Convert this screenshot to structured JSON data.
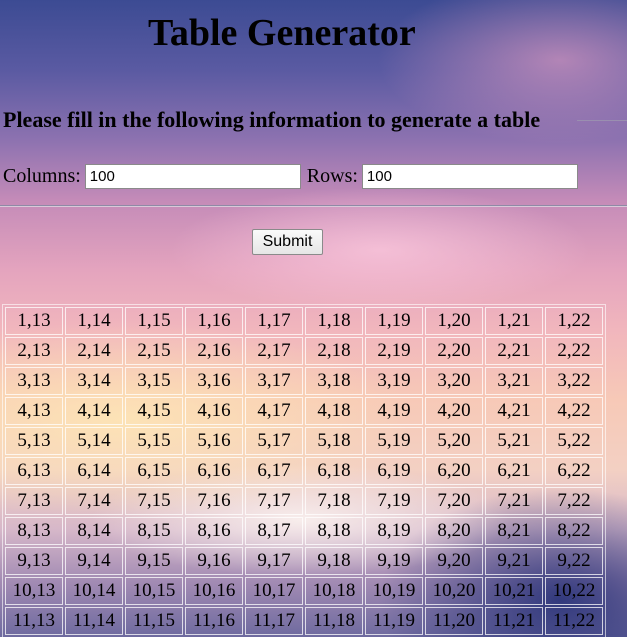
{
  "page": {
    "title": "Table Generator",
    "subtitle": "Please fill in the following information to generate a table"
  },
  "form": {
    "columns_label": "Columns:",
    "columns_value": "100",
    "rows_label": "Rows:",
    "rows_value": "100",
    "submit_label": "Submit"
  },
  "table": {
    "rows": [
      [
        "1,13",
        "1,14",
        "1,15",
        "1,16",
        "1,17",
        "1,18",
        "1,19",
        "1,20",
        "1,21",
        "1,22"
      ],
      [
        "2,13",
        "2,14",
        "2,15",
        "2,16",
        "2,17",
        "2,18",
        "2,19",
        "2,20",
        "2,21",
        "2,22"
      ],
      [
        "3,13",
        "3,14",
        "3,15",
        "3,16",
        "3,17",
        "3,18",
        "3,19",
        "3,20",
        "3,21",
        "3,22"
      ],
      [
        "4,13",
        "4,14",
        "4,15",
        "4,16",
        "4,17",
        "4,18",
        "4,19",
        "4,20",
        "4,21",
        "4,22"
      ],
      [
        "5,13",
        "5,14",
        "5,15",
        "5,16",
        "5,17",
        "5,18",
        "5,19",
        "5,20",
        "5,21",
        "5,22"
      ],
      [
        "6,13",
        "6,14",
        "6,15",
        "6,16",
        "6,17",
        "6,18",
        "6,19",
        "6,20",
        "6,21",
        "6,22"
      ],
      [
        "7,13",
        "7,14",
        "7,15",
        "7,16",
        "7,17",
        "7,18",
        "7,19",
        "7,20",
        "7,21",
        "7,22"
      ],
      [
        "8,13",
        "8,14",
        "8,15",
        "8,16",
        "8,17",
        "8,18",
        "8,19",
        "8,20",
        "8,21",
        "8,22"
      ],
      [
        "9,13",
        "9,14",
        "9,15",
        "9,16",
        "9,17",
        "9,18",
        "9,19",
        "9,20",
        "9,21",
        "9,22"
      ],
      [
        "10,13",
        "10,14",
        "10,15",
        "10,16",
        "10,17",
        "10,18",
        "10,19",
        "10,20",
        "10,21",
        "10,22"
      ],
      [
        "11,13",
        "11,14",
        "11,15",
        "11,16",
        "11,17",
        "11,18",
        "11,19",
        "11,20",
        "11,21",
        "11,22"
      ]
    ]
  }
}
